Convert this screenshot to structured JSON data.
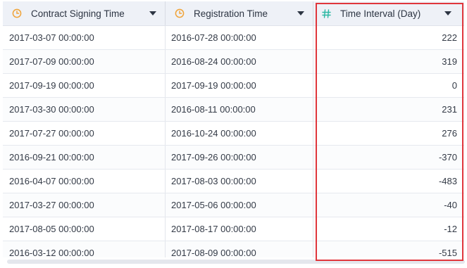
{
  "table": {
    "columns": [
      {
        "label": "Contract Signing Time",
        "icon": "clock-icon",
        "menu_icon": "dropdown-arrow-icon"
      },
      {
        "label": "Registration Time",
        "icon": "clock-icon",
        "menu_icon": "dropdown-arrow-icon"
      },
      {
        "label": "Time Interval (Day)",
        "icon": "hash-icon",
        "menu_icon": "dropdown-arrow-icon"
      }
    ],
    "rows": [
      {
        "contract_signing_time": "2017-03-07 00:00:00",
        "registration_time": "2016-07-28 00:00:00",
        "time_interval": "222"
      },
      {
        "contract_signing_time": "2017-07-09 00:00:00",
        "registration_time": "2016-08-24 00:00:00",
        "time_interval": "319"
      },
      {
        "contract_signing_time": "2017-09-19 00:00:00",
        "registration_time": "2017-09-19 00:00:00",
        "time_interval": "0"
      },
      {
        "contract_signing_time": "2017-03-30 00:00:00",
        "registration_time": "2016-08-11 00:00:00",
        "time_interval": "231"
      },
      {
        "contract_signing_time": "2017-07-27 00:00:00",
        "registration_time": "2016-10-24 00:00:00",
        "time_interval": "276"
      },
      {
        "contract_signing_time": "2016-09-21 00:00:00",
        "registration_time": "2017-09-26 00:00:00",
        "time_interval": "-370"
      },
      {
        "contract_signing_time": "2016-04-07 00:00:00",
        "registration_time": "2017-08-03 00:00:00",
        "time_interval": "-483"
      },
      {
        "contract_signing_time": "2017-03-27 00:00:00",
        "registration_time": "2017-05-06 00:00:00",
        "time_interval": "-40"
      },
      {
        "contract_signing_time": "2017-08-05 00:00:00",
        "registration_time": "2017-08-17 00:00:00",
        "time_interval": "-12"
      },
      {
        "contract_signing_time": "2016-03-12 00:00:00",
        "registration_time": "2017-08-09 00:00:00",
        "time_interval": "-515"
      }
    ]
  },
  "colors": {
    "header_background": "#eef1f7",
    "clock_icon": "#f0a43a",
    "hash_icon": "#2bb8a3",
    "highlight_border": "#e0363c",
    "text": "#333a46"
  }
}
